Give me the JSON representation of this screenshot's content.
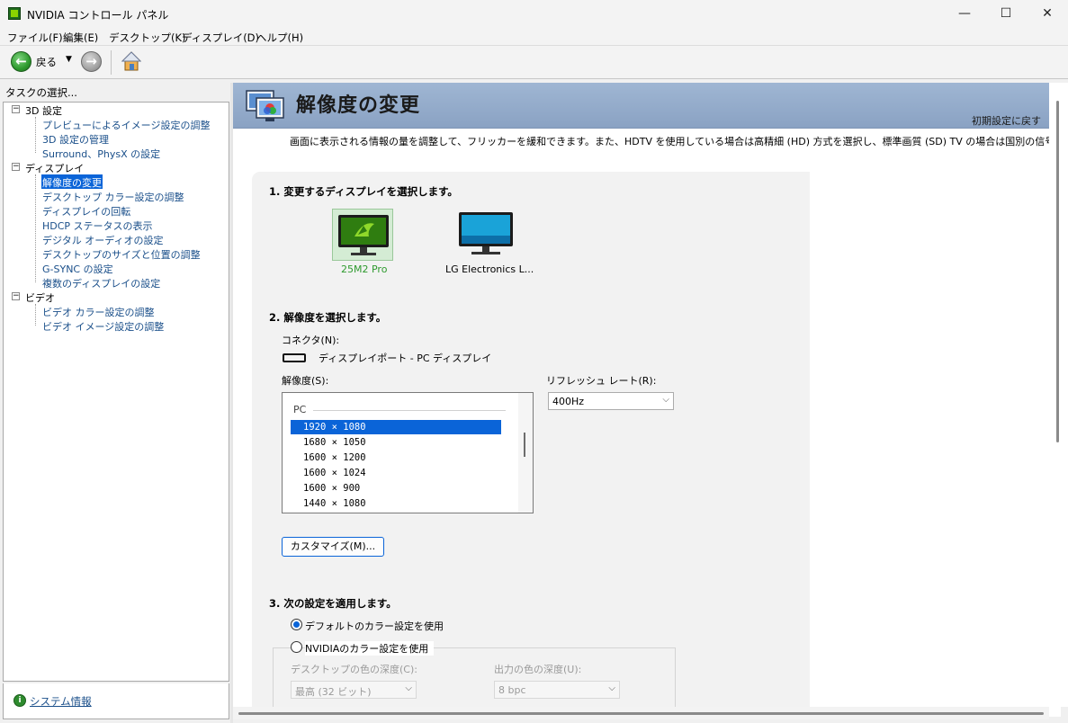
{
  "window": {
    "title": "NVIDIA コントロール パネル",
    "minimize": "—",
    "maximize": "☐",
    "close": "✕"
  },
  "menu": [
    "ファイル(F)",
    "編集(E)",
    "デスクトップ(K)",
    "ディスプレイ(D)",
    "ヘルプ(H)"
  ],
  "toolbar": {
    "back_label": "戻る",
    "back_glyph": "←",
    "fwd_glyph": "→",
    "dropdown_glyph": "▼"
  },
  "sidebar": {
    "header": "タスクの選択...",
    "categories": [
      {
        "label": "3D 設定",
        "items": [
          "プレビューによるイメージ設定の調整",
          "3D 設定の管理",
          "Surround、PhysX の設定"
        ]
      },
      {
        "label": "ディスプレイ",
        "items": [
          "解像度の変更",
          "デスクトップ カラー設定の調整",
          "ディスプレイの回転",
          "HDCP ステータスの表示",
          "デジタル オーディオの設定",
          "デスクトップのサイズと位置の調整",
          "G-SYNC の設定",
          "複数のディスプレイの設定"
        ]
      },
      {
        "label": "ビデオ",
        "items": [
          "ビデオ カラー設定の調整",
          "ビデオ イメージ設定の調整"
        ]
      }
    ],
    "selected_item": "解像度の変更",
    "system_info": "システム情報"
  },
  "main": {
    "title": "解像度の変更",
    "restore": "初期設定に戻す",
    "description": "画面に表示される情報の量を調整して、フリッカーを緩和できます。また、HDTV を使用している場合は高精細 (HD) 方式を選択し、標準画質 (SD) TV の場合は国別の信号を設定",
    "step1": "1. 変更するディスプレイを選択します。",
    "monitors": [
      {
        "name": "25M2 Pro",
        "selected": true
      },
      {
        "name": "LG Electronics L...",
        "selected": false
      }
    ],
    "step2": "2. 解像度を選択します。",
    "connector_label": "コネクタ(N):",
    "connector_value": "ディスプレイポート - PC ディスプレイ",
    "resolution_label": "解像度(S):",
    "resolution_group": "PC",
    "resolutions": [
      "1920 × 1080",
      "1680 × 1050",
      "1600 × 1200",
      "1600 × 1024",
      "1600 × 900",
      "1440 × 1080"
    ],
    "selected_resolution": "1920 × 1080",
    "refresh_label": "リフレッシュ レート(R):",
    "refresh_value": "400Hz",
    "customize_button": "カスタマイズ(M)...",
    "step3": "3. 次の設定を適用します。",
    "radio_default": "デフォルトのカラー設定を使用",
    "radio_nvidia": "NVIDIAのカラー設定を使用",
    "desktop_depth_label": "デスクトップの色の深度(C):",
    "desktop_depth_value": "最高 (32 ビット)",
    "output_depth_label": "出力の色の深度(U):",
    "output_depth_value": "8 bpc"
  },
  "colors": {
    "accent": "#0a64d8",
    "banner": "#9fb6d3",
    "link": "#1a4f8a",
    "nvidia_green": "#76b900"
  }
}
